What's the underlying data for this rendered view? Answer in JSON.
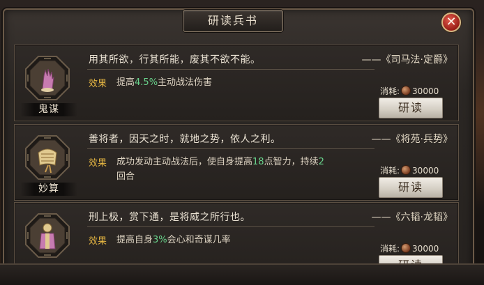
{
  "dialog": {
    "title": "研读兵书"
  },
  "close_icon": "close-icon",
  "colors": {
    "effect_label": "#e3b442",
    "highlight": "#69d38c",
    "text": "#ddd3c2"
  },
  "cards": [
    {
      "name": "鬼谋",
      "icon": "hand-icon",
      "quote": "用其所欲，行其所能，废其不欲不能。",
      "source": "——《司马法·定爵》",
      "effect_label": "效果",
      "effect_parts": [
        "提高",
        "4.5%",
        "主动战法伤害"
      ],
      "cost_label": "消耗:",
      "cost_value": "30000",
      "button_label": "研读"
    },
    {
      "name": "妙算",
      "icon": "scroll-icon",
      "quote": "善将者，因天之时，就地之势，依人之利。",
      "source": "——《将苑·兵势》",
      "effect_label": "效果",
      "effect_parts": [
        "成功发动主动战法后，使自身提高",
        "18",
        "点智力，持续",
        "2",
        "回合"
      ],
      "cost_label": "消耗:",
      "cost_value": "30000",
      "button_label": "研读"
    },
    {
      "name": "",
      "icon": "figure-icon",
      "quote": "刑上极，赏下通，是将威之所行也。",
      "source": "——《六韬·龙韬》",
      "effect_label": "效果",
      "effect_parts": [
        "提高自身",
        "3%",
        "会心和奇谋几率"
      ],
      "cost_label": "消耗:",
      "cost_value": "30000",
      "button_label": "研读"
    }
  ]
}
